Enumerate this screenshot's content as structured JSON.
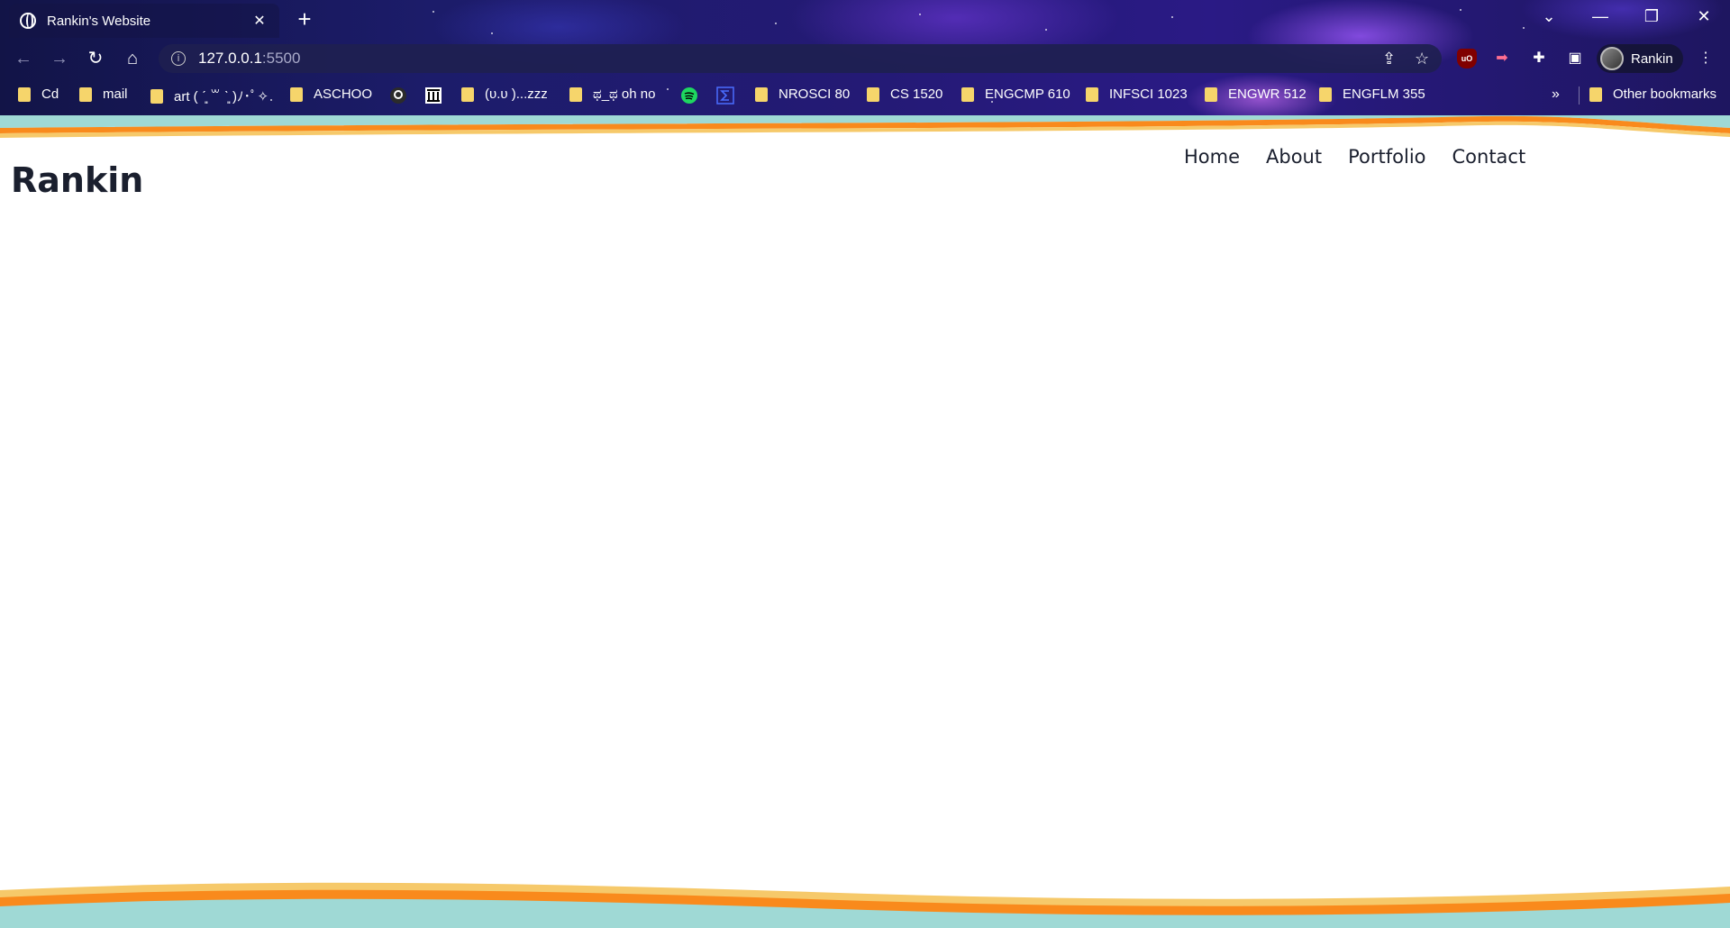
{
  "browser": {
    "tab_title": "Rankin's Website",
    "tab_close": "✕",
    "new_tab": "+",
    "address_host": "127.0.0.1",
    "address_port": ":5500",
    "profile_name": "Rankin",
    "bookmarks": [
      {
        "label": "Cd",
        "icon": "folder"
      },
      {
        "label": "mail",
        "icon": "folder"
      },
      {
        "label": "art ( ˊ͈ ꒳ ˋ͈ )ﾉ･ﾟ✧",
        "icon": "folder"
      },
      {
        "label": "ASCHOO",
        "icon": "folder"
      },
      {
        "label": "",
        "icon": "github-icon"
      },
      {
        "label": "",
        "icon": "library-icon"
      },
      {
        "label": "(υ.υ )...zzz",
        "icon": "folder"
      },
      {
        "label": "ಥ_ಥ oh no",
        "icon": "folder"
      },
      {
        "label": "",
        "icon": "spotify-icon"
      },
      {
        "label": "",
        "icon": "sigma-icon"
      },
      {
        "label": "NROSCI 80",
        "icon": "folder"
      },
      {
        "label": "CS 1520",
        "icon": "folder"
      },
      {
        "label": "ENGCMP 610",
        "icon": "folder"
      },
      {
        "label": "INFSCI 1023",
        "icon": "folder"
      },
      {
        "label": "ENGWR 512",
        "icon": "folder"
      },
      {
        "label": "ENGFLM 355",
        "icon": "folder"
      }
    ],
    "bookmarks_more": "»",
    "other_bookmarks": "Other bookmarks"
  },
  "page": {
    "logo": "Rankin",
    "nav": [
      "Home",
      "About",
      "Portfolio",
      "Contact"
    ]
  },
  "colors": {
    "wave_teal": "#9fd9d5",
    "wave_orange": "#f98a1c",
    "wave_yellow": "#f6c96a",
    "text_dark": "#1a1f2e"
  }
}
